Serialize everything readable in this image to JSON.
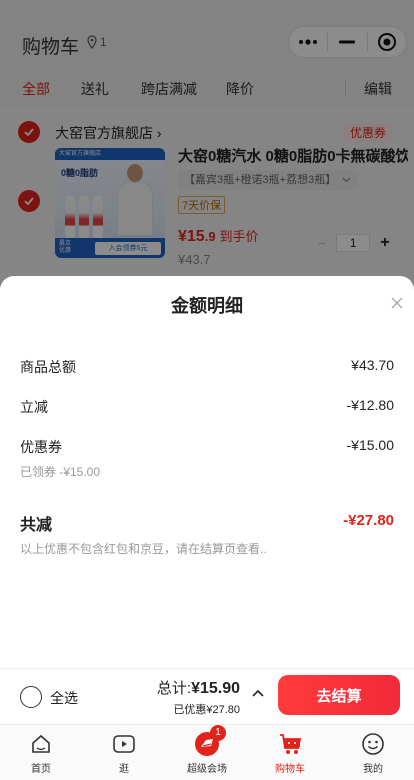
{
  "header": {
    "title": "购物车",
    "location_count": "1"
  },
  "tabs": [
    {
      "label": "全部"
    },
    {
      "label": "送礼"
    },
    {
      "label": "跨店满减"
    },
    {
      "label": "降价"
    }
  ],
  "edit_label": "编辑",
  "store": {
    "name": "大窑官方旗舰店",
    "chevron": "›",
    "coupon_label": "优惠券"
  },
  "product": {
    "title": "大窑0糖汽水 0糖0脂肪0卡無碳酸饮",
    "variant": "【嘉宾3瓶+橙诺3瓶+荔想3瓶】",
    "tag": "7天价保",
    "price_symbol": "¥",
    "price_int": "15",
    "price_dec": ".9",
    "price_suffix": "到手价",
    "original_price": "¥43.7",
    "quantity": "1",
    "image": {
      "top_text": "大窑官方旗舰店",
      "zero_text": "0糖0脂肪",
      "brand_line1": "晨京",
      "brand_line2": "优惠",
      "offer_text": "入会领券5元"
    }
  },
  "sheet": {
    "title": "金额明细",
    "rows": [
      {
        "label": "商品总额",
        "value": "¥43.70"
      },
      {
        "label": "立减",
        "value": "-¥12.80"
      },
      {
        "label": "优惠券",
        "value": "-¥15.00",
        "sub": "已领券 -¥15.00"
      }
    ],
    "total": {
      "label": "共减",
      "value": "-¥27.80"
    },
    "note": "以上优惠不包含红包和京豆，请在结算页查看.."
  },
  "checkout": {
    "select_all": "全选",
    "total_prefix": "总计:",
    "total_value": "¥15.90",
    "discount_text": "已优惠¥27.80",
    "button": "去结算"
  },
  "tabbar": [
    {
      "label": "首页",
      "icon": "home-icon"
    },
    {
      "label": "逛",
      "icon": "video-icon"
    },
    {
      "label": "超级会场",
      "icon": "venue-icon",
      "badge": "1"
    },
    {
      "label": "购物车",
      "icon": "cart-icon"
    },
    {
      "label": "我的",
      "icon": "profile-icon"
    }
  ],
  "colors": {
    "accent": "#e2231a",
    "checkout_gradient_start": "#ff3b3b",
    "checkout_gradient_end": "#f22a3a"
  }
}
